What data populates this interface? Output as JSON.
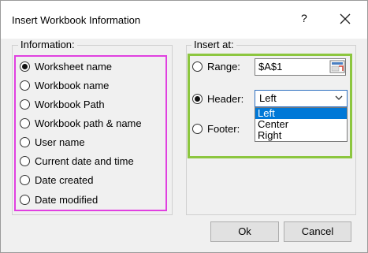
{
  "window": {
    "title": "Insert Workbook Information",
    "help_label": "?"
  },
  "information": {
    "label": "Information:",
    "options": [
      {
        "label": "Worksheet name",
        "checked": true
      },
      {
        "label": "Workbook name",
        "checked": false
      },
      {
        "label": "Workbook Path",
        "checked": false
      },
      {
        "label": "Workbook path & name",
        "checked": false
      },
      {
        "label": "User name",
        "checked": false
      },
      {
        "label": "Current date and time",
        "checked": false
      },
      {
        "label": "Date created",
        "checked": false
      },
      {
        "label": "Date modified",
        "checked": false
      }
    ]
  },
  "insert_at": {
    "label": "Insert at:",
    "range": {
      "label": "Range:",
      "value": "$A$1",
      "checked": false
    },
    "header": {
      "label": "Header:",
      "checked": true,
      "selected": "Left",
      "options": [
        "Left",
        "Center",
        "Right"
      ]
    },
    "footer": {
      "label": "Footer:",
      "checked": false
    }
  },
  "buttons": {
    "ok": "Ok",
    "cancel": "Cancel"
  },
  "icons": {
    "close": "close-icon",
    "range_select": "range-select-icon",
    "dropdown": "chevron-down-icon"
  },
  "colors": {
    "highlight_left": "#e040e0",
    "highlight_right": "#8cc63f",
    "selection": "#0078d7"
  }
}
